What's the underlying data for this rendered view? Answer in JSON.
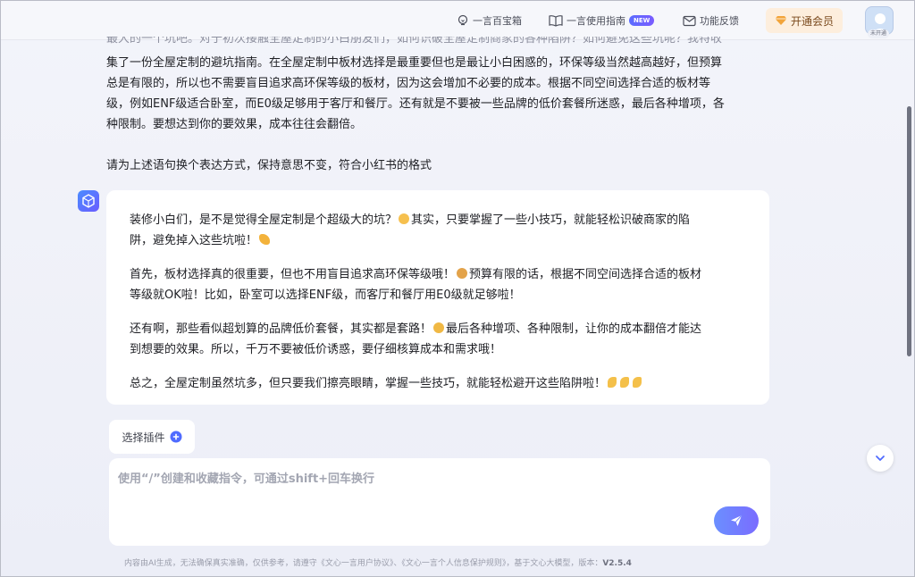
{
  "header": {
    "item1_label": "一言百宝箱",
    "item2_label": "一言使用指南",
    "item2_badge": "NEW",
    "item3_label": "功能反馈",
    "vip_label": "开通会员",
    "avatar_tag": "未开通"
  },
  "user_message": {
    "line_cut": "最大的一个坑吧。对于初次接触全屋定制的小白朋友们，如何识破全屋定制商家的各种陷阱？如何避免这些坑呢？我特收",
    "line1": "集了一份全屋定制的避坑指南。在全屋定制中板材选择是最重要但也是最让小白困惑的，环保等级当然越高越好，但预算",
    "line2": "总是有限的，所以也不需要盲目追求高环保等级的板材，因为这会增加不必要的成本。根据不同空间选择合适的板材等",
    "line3": "级，例如ENF级适合卧室，而E0级足够用于客厅和餐厅。还有就是不要被一些品牌的低价套餐所迷惑，最后各种增项，各",
    "line4": "种限制。要想达到你的要效果，成本往往会翻倍。",
    "request": "请为上述语句换个表达方式，保持意思不变，符合小红书的格式"
  },
  "bot_message": {
    "p1a": "装修小白们，是不是觉得全屋定制是个超级大的坑？",
    "p1b": "其实，只要掌握了一些小技巧，就能轻松识破商家的陷",
    "p1c": "阱，避免掉入这些坑啦！",
    "p2a": "首先，板材选择真的很重要，但也不用盲目追求高环保等级哦！",
    "p2b": "预算有限的话，根据不同空间选择合适的板材",
    "p2c": "等级就OK啦！比如，卧室可以选择ENF级，而客厅和餐厅用E0级就足够啦！",
    "p3a": "还有啊，那些看似超划算的品牌低价套餐，其实都是套路！",
    "p3b": "最后各种增项、各种限制，让你的成本翻倍才能达",
    "p3c": "到想要的效果。所以，千万不要被低价诱惑，要仔细核算成本和需求哦！",
    "p4": "总之，全屋定制虽然坑多，但只要我们擦亮眼睛，掌握一些技巧，就能轻松避开这些陷阱啦！"
  },
  "composer": {
    "plugin_label": "选择插件",
    "placeholder": "使用“/”创建和收藏指令，可通过shift+回车换行"
  },
  "footer": {
    "text": "内容由AI生成，无法确保真实准确，仅供参考，请遵守《文心一言用户协议》、《文心一言个人信息保护规则》，基于文心大模型，版本：",
    "version": "V2.5.4"
  },
  "icons": {
    "lightbulb": "lightbulb-icon",
    "book": "book-icon",
    "mail": "mail-icon",
    "diamond": "diamond-icon",
    "plus": "plus-circle-icon",
    "send": "send-icon",
    "chevron": "chevron-down-icon",
    "bot": "cube-logo-icon"
  }
}
